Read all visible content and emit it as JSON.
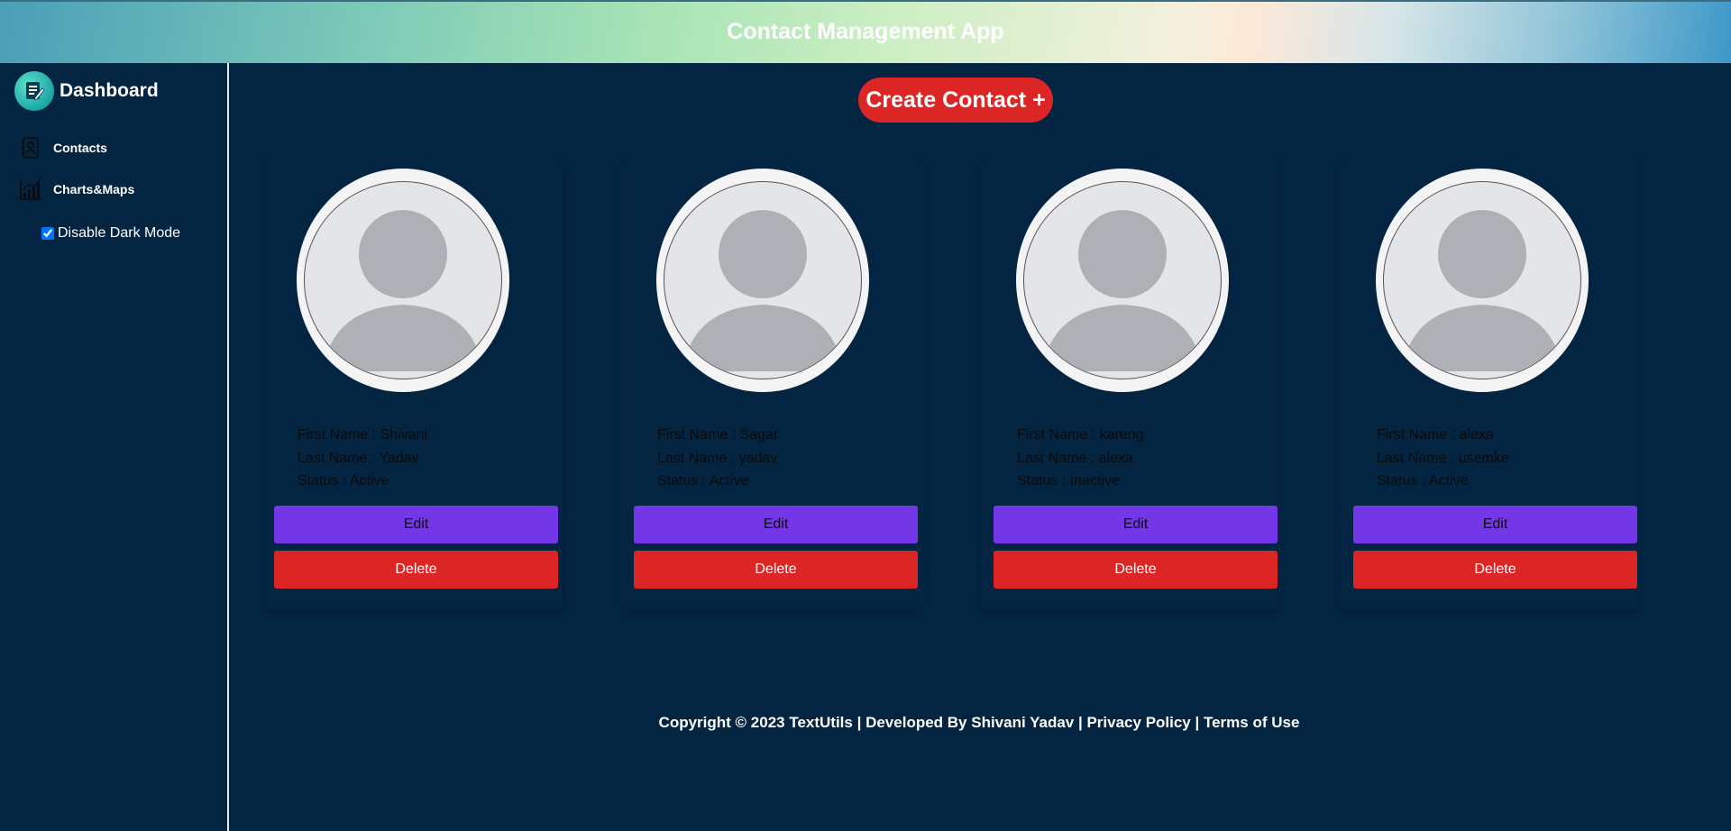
{
  "header": {
    "title": "Contact Management App"
  },
  "sidebar": {
    "brand": "Dashboard",
    "items": [
      {
        "label": "Contacts",
        "icon": "contact-book-icon"
      },
      {
        "label": "Charts&Maps",
        "icon": "bar-chart-icon"
      }
    ],
    "dark_mode": {
      "label": "Disable Dark Mode",
      "checked": true
    }
  },
  "main": {
    "create_label": "Create Contact +",
    "contacts": [
      {
        "first": "First Name : Shivani",
        "last": "Last Name : Yadav",
        "status": "Status : Active",
        "edit": "Edit",
        "delete": "Delete"
      },
      {
        "first": "First Name : Sagar",
        "last": "Last Name : yadav",
        "status": "Status : Active",
        "edit": "Edit",
        "delete": "Delete"
      },
      {
        "first": "First Name : kareng",
        "last": "Last Name : alexa",
        "status": "Status : Inactive",
        "edit": "Edit",
        "delete": "Delete"
      },
      {
        "first": "First Name : alexa",
        "last": "Last Name : usemke",
        "status": "Status : Active",
        "edit": "Edit",
        "delete": "Delete"
      }
    ]
  },
  "footer": {
    "copyright": "Copyright © 2023 TextUtils",
    "sep": " | ",
    "developer": "Developed By Shivani Yadav",
    "privacy": "Privacy Policy",
    "terms": "Terms of Use"
  },
  "colors": {
    "background": "#032541",
    "edit_button": "#7337e8",
    "delete_button": "#dc2626",
    "create_button": "#dc2626"
  }
}
